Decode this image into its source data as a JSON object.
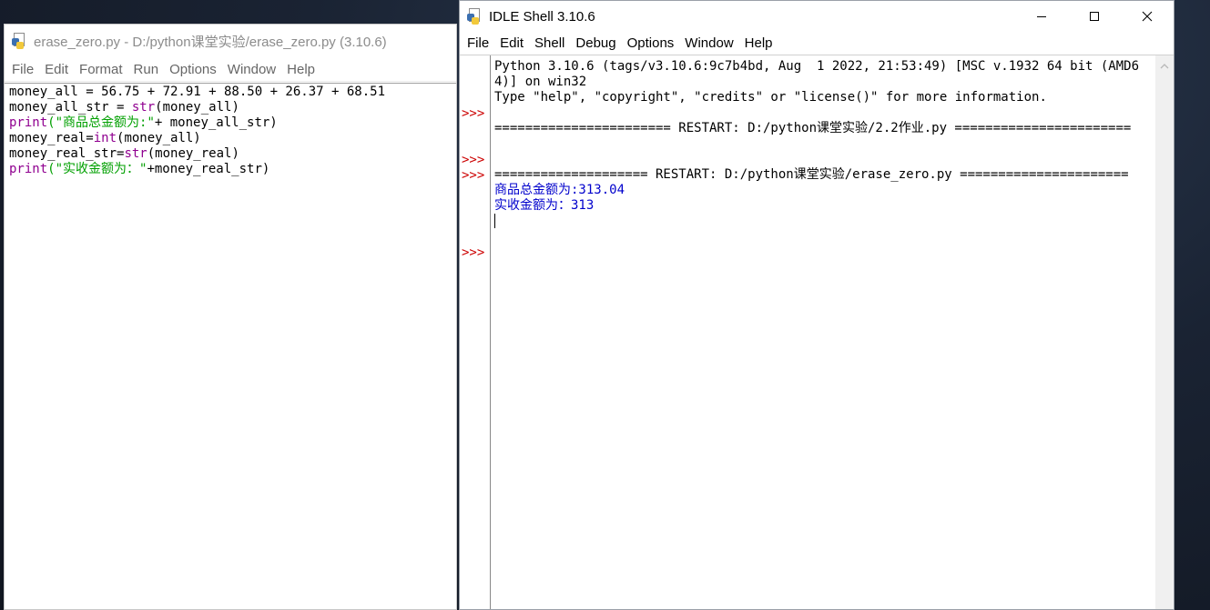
{
  "editor": {
    "title": "erase_zero.py - D:/python课堂实验/erase_zero.py (3.10.6)",
    "menu": [
      "File",
      "Edit",
      "Format",
      "Run",
      "Options",
      "Window",
      "Help"
    ],
    "code": {
      "l1": "money_all = 56.75 + 72.91 + 88.50 + 26.37 + 68.51",
      "l2_a": "money_all_str = ",
      "l2_kw": "str",
      "l2_b": "(money_all)",
      "l3_kw": "print",
      "l3_str": "(\"商品总金额为:\"",
      "l3_b": "+ money_all_str)",
      "l4_a": "money_real=",
      "l4_kw": "int",
      "l4_b": "(money_all)",
      "l5_a": "money_real_str=",
      "l5_kw": "str",
      "l5_b": "(money_real)",
      "l6_kw": "print",
      "l6_str": "(\"实收金额为：\"",
      "l6_b": "+money_real_str)"
    }
  },
  "shell": {
    "title": "IDLE Shell 3.10.6",
    "menu": [
      "File",
      "Edit",
      "Shell",
      "Debug",
      "Options",
      "Window",
      "Help"
    ],
    "prompt": ">>>",
    "banner": "Python 3.10.6 (tags/v3.10.6:9c7b4bd, Aug  1 2022, 21:53:49) [MSC v.1932 64 bit (AMD64)] on win32\nType \"help\", \"copyright\", \"credits\" or \"license()\" for more information.",
    "restart1": "======================= RESTART: D:/python课堂实验/2.2作业.py =======================",
    "restart2": "==================== RESTART: D:/python课堂实验/erase_zero.py ======================",
    "out1": "商品总金额为:313.04",
    "out2": "实收金额为：313"
  }
}
